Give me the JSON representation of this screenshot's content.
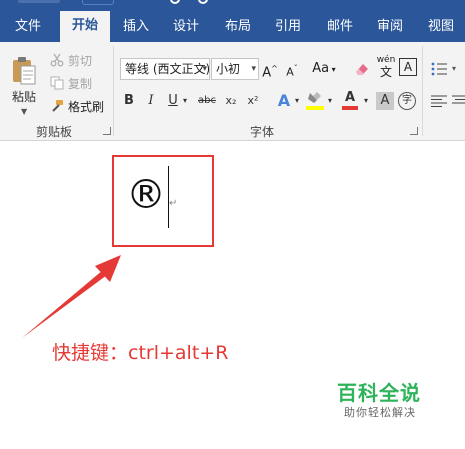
{
  "tabs": [
    {
      "label": "文件",
      "active": false
    },
    {
      "label": "开始",
      "active": true
    },
    {
      "label": "插入",
      "active": false
    },
    {
      "label": "设计",
      "active": false
    },
    {
      "label": "布局",
      "active": false
    },
    {
      "label": "引用",
      "active": false
    },
    {
      "label": "邮件",
      "active": false
    },
    {
      "label": "审阅",
      "active": false
    },
    {
      "label": "视图",
      "active": false
    }
  ],
  "clipboard": {
    "group_label": "剪贴板",
    "paste_label": "粘贴",
    "cut_label": "剪切",
    "copy_label": "复制",
    "format_painter_label": "格式刷"
  },
  "font": {
    "group_label": "字体",
    "font_name": "等线 (西文正文)",
    "font_size": "小初",
    "grow_label": "A",
    "shrink_label": "A",
    "change_case_label": "Aa",
    "phonetic_label": "wén",
    "phonetic_sub": "文",
    "char_border_label": "A",
    "bold": "B",
    "italic": "I",
    "underline": "U",
    "strikethrough": "abc",
    "subscript": "x₂",
    "superscript": "x²",
    "text_effects": "A",
    "font_color": "A",
    "char_shading": "A",
    "enclose_char": "字",
    "font_color_hex": "#e53935",
    "highlight_hex": "#ffff00"
  },
  "document": {
    "symbol": "®",
    "paragraph_mark": "↵",
    "shortcut_text": "快捷键：ctrl+alt+R",
    "annotation_color": "#e53935"
  },
  "watermark": {
    "title": "百科全说",
    "subtitle": "助你轻松解决",
    "color": "#2fb35a"
  }
}
